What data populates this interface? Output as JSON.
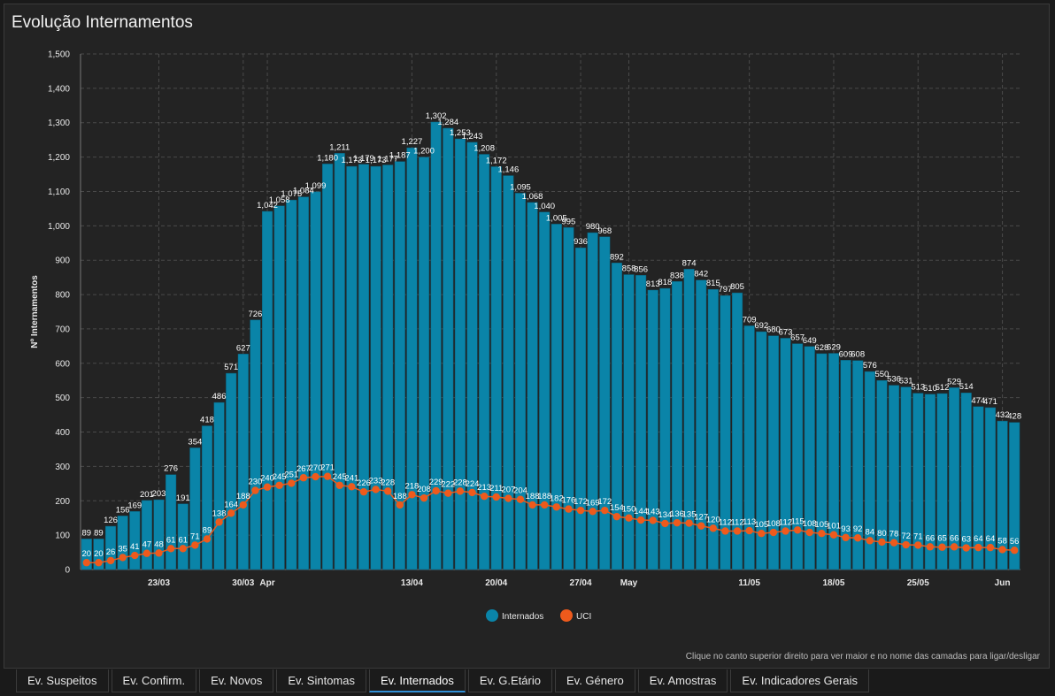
{
  "title": "Evolução Internamentos",
  "hint": "Clique no canto superior direito para ver maior e no nome das camadas para ligar/desligar",
  "tabs": [
    {
      "label": "Ev. Suspeitos",
      "active": false
    },
    {
      "label": "Ev. Confirm.",
      "active": false
    },
    {
      "label": "Ev. Novos",
      "active": false
    },
    {
      "label": "Ev. Sintomas",
      "active": false
    },
    {
      "label": "Ev. Internados",
      "active": true
    },
    {
      "label": "Ev. G.Etário",
      "active": false
    },
    {
      "label": "Ev. Género",
      "active": false
    },
    {
      "label": "Ev. Amostras",
      "active": false
    },
    {
      "label": "Ev. Indicadores Gerais",
      "active": false
    }
  ],
  "colors": {
    "bars": "#0a84a8",
    "uci": "#ee5a1c",
    "grid": "#4a4a4a",
    "text": "#e8e8e8"
  },
  "chart_data": {
    "type": "bar",
    "ylabel": "Nº Internamentos",
    "ylim": [
      0,
      1500
    ],
    "yticks": [
      "0",
      "100",
      "200",
      "300",
      "400",
      "500",
      "600",
      "700",
      "800",
      "900",
      "1,000",
      "1,100",
      "1,200",
      "1,300",
      "1,400",
      "1,500"
    ],
    "xticks": [
      {
        "label": "23/03",
        "index": 6
      },
      {
        "label": "30/03",
        "index": 13
      },
      {
        "label": "Apr",
        "index": 15
      },
      {
        "label": "13/04",
        "index": 27
      },
      {
        "label": "20/04",
        "index": 34
      },
      {
        "label": "27/04",
        "index": 41
      },
      {
        "label": "May",
        "index": 45
      },
      {
        "label": "11/05",
        "index": 55
      },
      {
        "label": "18/05",
        "index": 62
      },
      {
        "label": "25/05",
        "index": 69
      },
      {
        "label": "Jun",
        "index": 76
      }
    ],
    "grid": true,
    "legend_position": "bottom-center",
    "series": [
      {
        "name": "Internados",
        "type": "bar",
        "values": [
          89,
          89,
          126,
          156,
          169,
          201,
          203,
          276,
          191,
          354,
          418,
          486,
          571,
          627,
          726,
          1042,
          1058,
          1075,
          1084,
          1099,
          1180,
          1211,
          1173,
          1179,
          1173,
          1177,
          1187,
          1227,
          1200,
          1302,
          1284,
          1253,
          1243,
          1208,
          1172,
          1146,
          1095,
          1068,
          1040,
          1005,
          995,
          936,
          980,
          968,
          892,
          858,
          856,
          813,
          818,
          838,
          874,
          842,
          815,
          797,
          805,
          709,
          692,
          680,
          673,
          657,
          649,
          628,
          629,
          609,
          608,
          576,
          550,
          536,
          531,
          513,
          510,
          512,
          529,
          514,
          474,
          471,
          432,
          428
        ]
      },
      {
        "name": "UCI",
        "type": "line",
        "values": [
          20,
          20,
          26,
          35,
          41,
          47,
          48,
          61,
          61,
          71,
          89,
          138,
          164,
          188,
          230,
          240,
          245,
          251,
          267,
          270,
          271,
          245,
          241,
          226,
          233,
          228,
          188,
          218,
          208,
          229,
          222,
          228,
          224,
          213,
          211,
          207,
          204,
          188,
          188,
          182,
          176,
          172,
          169,
          172,
          154,
          150,
          144,
          143,
          134,
          136,
          135,
          127,
          120,
          112,
          112,
          113,
          105,
          108,
          112,
          115,
          108,
          105,
          101,
          93,
          92,
          84,
          80,
          78,
          72,
          71,
          66,
          65,
          66,
          63,
          64,
          64,
          58,
          56
        ]
      }
    ]
  }
}
